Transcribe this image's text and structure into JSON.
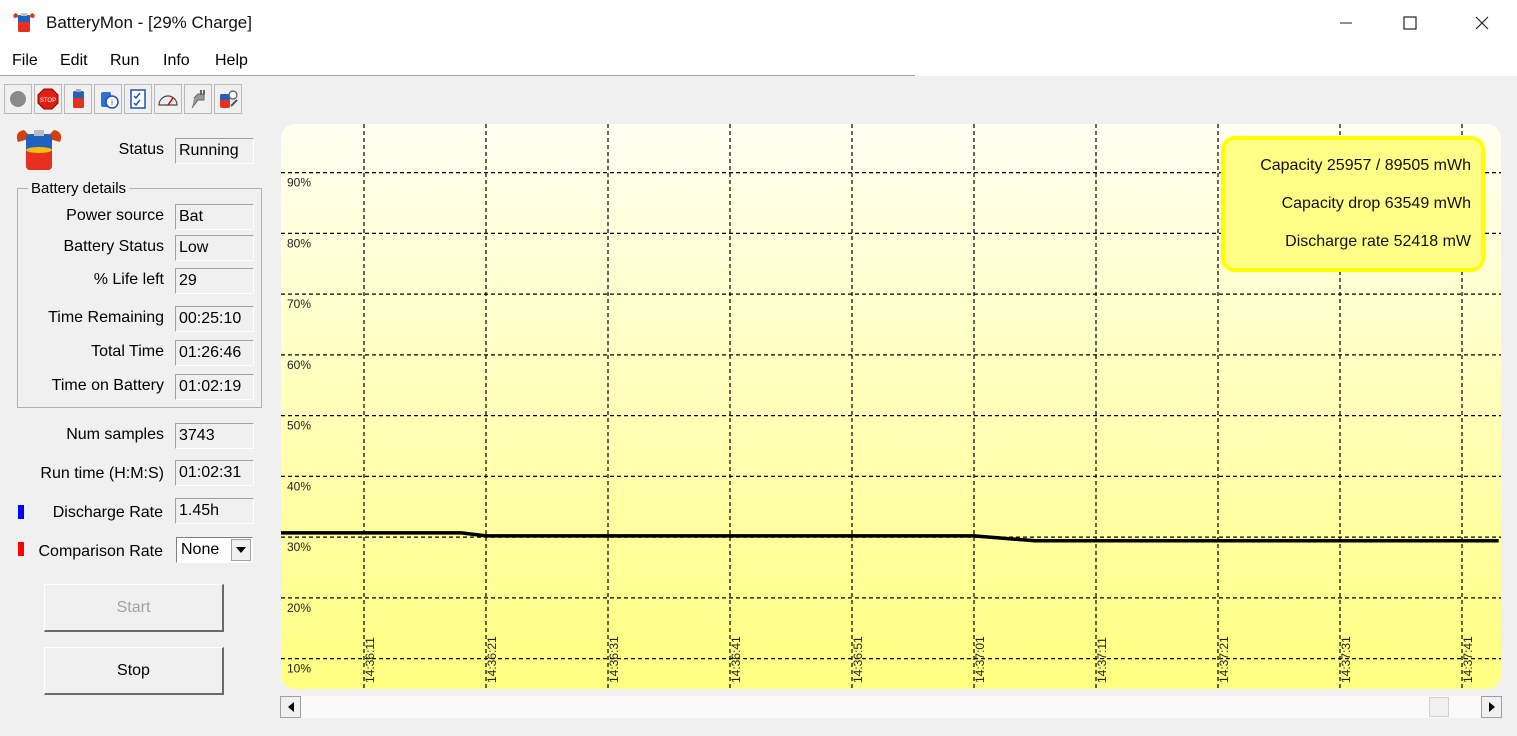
{
  "window": {
    "title": "BatteryMon - [29% Charge]"
  },
  "menu": [
    "File",
    "Edit",
    "Run",
    "Info",
    "Help"
  ],
  "toolbar_icons": [
    "stop-circle-icon",
    "stop-sign-icon",
    "battery-icon",
    "battery-info-icon",
    "checklist-icon",
    "gauge-icon",
    "plug-icon",
    "battery-settings-icon"
  ],
  "status": {
    "label": "Status",
    "value": "Running"
  },
  "battery_details": {
    "title": "Battery details",
    "fields": [
      {
        "label": "Power source",
        "value": "Bat"
      },
      {
        "label": "Battery Status",
        "value": "Low"
      },
      {
        "label": "% Life left",
        "value": "29"
      },
      {
        "label": "Time Remaining",
        "value": "00:25:10"
      },
      {
        "label": "Total Time",
        "value": "01:26:46"
      },
      {
        "label": "Time on Battery",
        "value": "01:02:19"
      }
    ]
  },
  "stats": [
    {
      "label": "Num samples",
      "value": "3743"
    },
    {
      "label": "Run time (H:M:S)",
      "value": "01:02:31"
    }
  ],
  "discharge": {
    "label": "Discharge Rate",
    "value": "1.45h",
    "marker_color": "#0000ff"
  },
  "comparison": {
    "label": "Comparison Rate",
    "value": "None",
    "marker_color": "#ff0000"
  },
  "buttons": {
    "start": "Start",
    "stop": "Stop"
  },
  "colors": {
    "chart_bg_top": "#fffff2",
    "chart_bg_bottom": "#ffff80",
    "legend_bg": "#ffff88",
    "legend_border": "#ffff00",
    "main_line": "#000000",
    "discharge_line": "#0000ff"
  },
  "chart_data": {
    "type": "line",
    "y_unit": "%",
    "y_ticks": [
      "90%",
      "80%",
      "70%",
      "60%",
      "50%",
      "40%",
      "30%",
      "20%",
      "10%"
    ],
    "ylim": [
      5,
      98
    ],
    "x_ticks": [
      "14:36:11",
      "14:36:21",
      "14:36:31",
      "14:36:41",
      "14:36:51",
      "14:37:01",
      "14:37:11",
      "14:37:21",
      "14:37:31",
      "14:37:41"
    ],
    "grid": true,
    "legend_placement": "top-right",
    "info_lines": [
      "Capacity 25957 / 89505 mWh",
      "Capacity drop 63549 mWh",
      "Discharge rate 52418 mW"
    ],
    "series": [
      {
        "x": [
          "14:36:04",
          "14:36:19",
          "14:36:21",
          "14:37:01",
          "14:37:06",
          "14:37:44"
        ],
        "values": [
          30.7,
          30.7,
          30.2,
          30.2,
          29.4,
          29.4
        ]
      }
    ]
  }
}
